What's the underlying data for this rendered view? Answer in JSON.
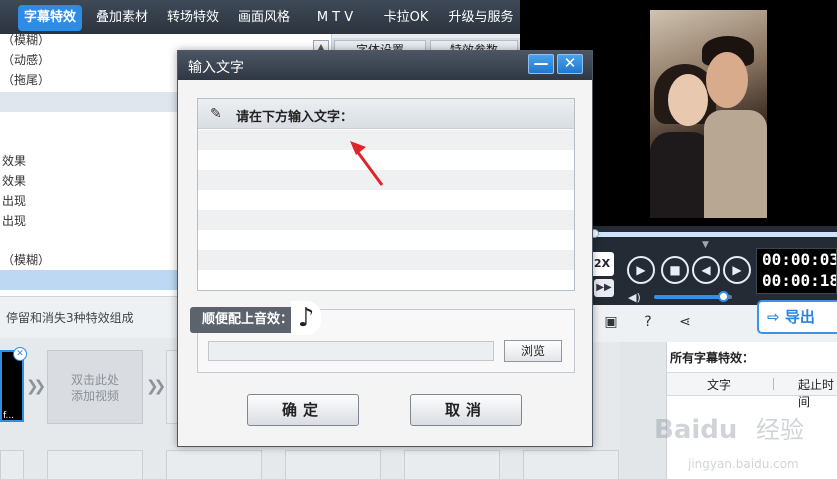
{
  "top_tabs": [
    {
      "label": "字幕特效",
      "active": true
    },
    {
      "label": "叠加素材",
      "active": false
    },
    {
      "label": "转场特效",
      "active": false
    },
    {
      "label": "画面风格",
      "active": false
    },
    {
      "label": "M T V",
      "active": false
    },
    {
      "label": "卡拉OK",
      "active": false
    },
    {
      "label": "升级与服务",
      "active": false
    }
  ],
  "effect_list": [
    "（模糊）",
    "（动感）",
    "（拖尾）",
    "效果",
    "效果",
    "出现",
    "出现",
    "（模糊）"
  ],
  "panel_tabs": [
    "字体设置",
    "特效参数"
  ],
  "effect_description": "停留和消失3种特效组成",
  "timeline": {
    "thumb_caption": "f...",
    "add_video_line1": "双击此处",
    "add_video_line2": "添加视频"
  },
  "player": {
    "speed_label": "2X",
    "ff_label": "▶▶",
    "time_current": "00:00:03",
    "time_total": "00:00:18",
    "volume_level": 0.9
  },
  "toolbar": {
    "export_label": "导出"
  },
  "subtitle_panel": {
    "title": "所有字幕特效：",
    "col_text": "文字",
    "col_time": "起止时间"
  },
  "dialog": {
    "title": "输入文字",
    "minimize_label": "—",
    "close_label": "✕",
    "prompt_label": "请在下方输入文字：",
    "text_value": "",
    "sound_label": "顺便配上音效：",
    "sound_file_value": "",
    "browse_label": "浏览",
    "ok_label": "确定",
    "cancel_label": "取消"
  },
  "watermark": {
    "brand": "Baidu",
    "text": "经验",
    "url": "jingyan.baidu.com"
  },
  "colors": {
    "accent": "#2c8ce6",
    "dark_bar": "#2b333d",
    "arrow_red": "#e0242b"
  }
}
